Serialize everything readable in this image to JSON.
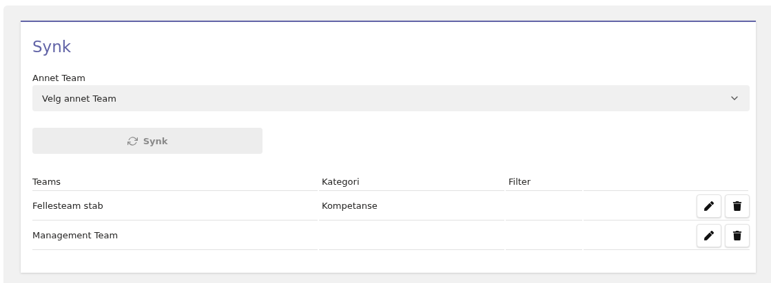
{
  "title": "Synk",
  "team_select": {
    "label": "Annet Team",
    "placeholder": "Velg annet Team"
  },
  "sync_button": {
    "label": "Synk",
    "disabled": true
  },
  "table": {
    "columns": [
      "Teams",
      "Kategori",
      "Filter"
    ],
    "rows": [
      {
        "team": "Fellesteam stab",
        "category": "Kompetanse",
        "filter": ""
      },
      {
        "team": "Management Team",
        "category": "",
        "filter": ""
      }
    ]
  }
}
